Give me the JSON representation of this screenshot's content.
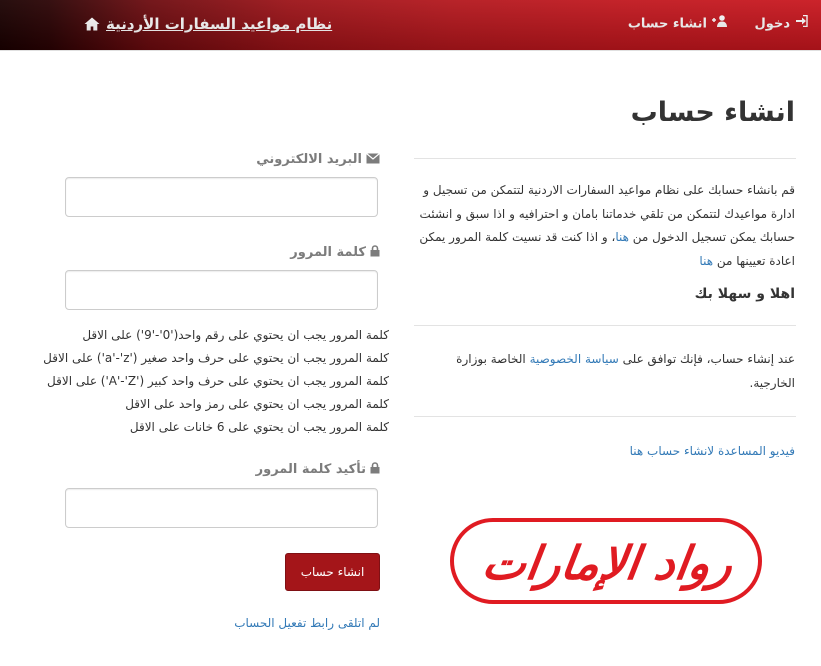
{
  "nav": {
    "brand_title": "نظام مواعيد السفارات الأردنية",
    "login_label": "دخول",
    "register_label": "انشاء حساب",
    "icons": {
      "home": "home-icon",
      "login": "sign-in-icon",
      "register": "user-plus-icon"
    }
  },
  "intro": {
    "heading": "انشاء حساب",
    "text_before_link1": "قم بانشاء حسابك على نظام مواعيد السفارات الاردنية لتتمكن من تسجيل و ادارة مواعيدك لتتمكن من تلقي خدماتنا بامان و احترافيه و اذا سبق و انشئت حسابك يمكن تسجيل الدخول من ",
    "link1": "هنا",
    "text_between_links": "، و اذا كنت قد نسيت كلمة المرور يمكن اعادة تعيينها من ",
    "link2": "هنا",
    "welcome": "اهلا و سهلا بك"
  },
  "privacy": {
    "text_before": "عند إنشاء حساب، فإنك توافق على ",
    "link": "سياسة الخصوصية",
    "text_after": " الخاصة بوزارة الخارجية."
  },
  "help_link": "فيديو المساعدة لانشاء حساب هنا",
  "form": {
    "email_label": "البريد الالكتروني",
    "email_value": "",
    "password_label": "كلمة المرور",
    "password_value": "",
    "password_rules": [
      "كلمة المرور يجب ان يحتوي على رقم واحد('0'-'9') على الاقل",
      "كلمة المرور يجب ان يحتوي على حرف واحد صغير ('a'-'z') على الاقل",
      "كلمة المرور يجب ان يحتوي على حرف واحد كبير ('A'-'Z') على الاقل",
      "كلمة المرور يجب ان يحتوي على رمز واحد على الاقل",
      "كلمة المرور يجب ان يحتوي على 6 خانات على الاقل"
    ],
    "confirm_label": "تأكيد كلمة المرور",
    "confirm_value": "",
    "submit_label": "انشاء حساب",
    "activation_link": "لم اتلقى رابط تفعيل الحساب"
  },
  "watermark": {
    "text": "رواد الإمارات",
    "color": "#e01b22"
  },
  "colors": {
    "accent": "#a41519",
    "link": "#337ab7",
    "label": "#7c7c7c"
  }
}
